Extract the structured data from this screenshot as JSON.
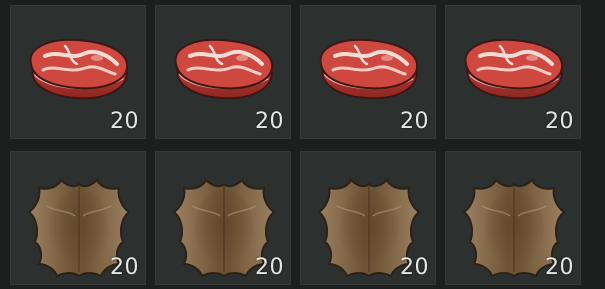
{
  "inventory": {
    "slots": [
      {
        "item": "raw-meat",
        "icon": "raw-meat-icon",
        "quantity": "20"
      },
      {
        "item": "raw-meat",
        "icon": "raw-meat-icon",
        "quantity": "20"
      },
      {
        "item": "raw-meat",
        "icon": "raw-meat-icon",
        "quantity": "20"
      },
      {
        "item": "raw-meat",
        "icon": "raw-meat-icon",
        "quantity": "20"
      },
      {
        "item": "animal-hide",
        "icon": "animal-hide-icon",
        "quantity": "20"
      },
      {
        "item": "animal-hide",
        "icon": "animal-hide-icon",
        "quantity": "20"
      },
      {
        "item": "animal-hide",
        "icon": "animal-hide-icon",
        "quantity": "20"
      },
      {
        "item": "animal-hide",
        "icon": "animal-hide-icon",
        "quantity": "20"
      }
    ]
  },
  "colors": {
    "background": "#1c1f1e",
    "slot": "#2c3130",
    "quantity_text": "#e6e7e3",
    "meat": "#c8423d",
    "fat": "#f3d6cf",
    "hide": "#8a6d4f"
  }
}
